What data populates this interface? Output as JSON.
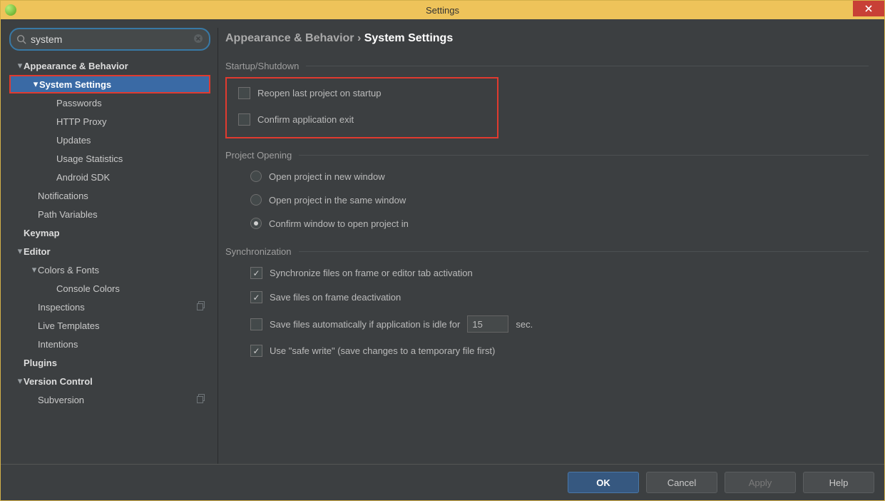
{
  "titlebar": {
    "title": "Settings"
  },
  "search": {
    "value": "system"
  },
  "sidebar": {
    "items": [
      {
        "label": "Appearance & Behavior",
        "indent": 1,
        "bold": true,
        "arrow": true
      },
      {
        "label": "System Settings",
        "indent": 2,
        "bold": true,
        "arrow": true,
        "selected": true,
        "redbox": true
      },
      {
        "label": "Passwords",
        "indent": 3
      },
      {
        "label": "HTTP Proxy",
        "indent": 3
      },
      {
        "label": "Updates",
        "indent": 3
      },
      {
        "label": "Usage Statistics",
        "indent": 3
      },
      {
        "label": "Android SDK",
        "indent": 3
      },
      {
        "label": "Notifications",
        "indent": 2
      },
      {
        "label": "Path Variables",
        "indent": 2
      },
      {
        "label": "Keymap",
        "indent": 1,
        "bold": true
      },
      {
        "label": "Editor",
        "indent": 1,
        "bold": true,
        "arrow": true
      },
      {
        "label": "Colors & Fonts",
        "indent": 2,
        "arrow": true
      },
      {
        "label": "Console Colors",
        "indent": 3
      },
      {
        "label": "Inspections",
        "indent": 2,
        "copy": true
      },
      {
        "label": "Live Templates",
        "indent": 2
      },
      {
        "label": "Intentions",
        "indent": 2
      },
      {
        "label": "Plugins",
        "indent": 1,
        "bold": true
      },
      {
        "label": "Version Control",
        "indent": 1,
        "bold": true,
        "arrow": true
      },
      {
        "label": "Subversion",
        "indent": 2,
        "copy": true
      }
    ]
  },
  "breadcrumb": {
    "parent": "Appearance & Behavior",
    "sep": " › ",
    "current": "System Settings"
  },
  "sections": {
    "startup": {
      "title": "Startup/Shutdown",
      "opts": [
        {
          "label": "Reopen last project on startup",
          "checked": false
        },
        {
          "label": "Confirm application exit",
          "checked": false
        }
      ]
    },
    "opening": {
      "title": "Project Opening",
      "opts": [
        {
          "label": "Open project in new window",
          "checked": false
        },
        {
          "label": "Open project in the same window",
          "checked": false
        },
        {
          "label": "Confirm window to open project in",
          "checked": true
        }
      ]
    },
    "sync": {
      "title": "Synchronization",
      "idle_value": "15",
      "idle_unit": "sec.",
      "opts": [
        {
          "label": "Synchronize files on frame or editor tab activation",
          "checked": true
        },
        {
          "label": "Save files on frame deactivation",
          "checked": true
        },
        {
          "label": "Save files automatically if application is idle for",
          "checked": false
        },
        {
          "label": "Use \"safe write\" (save changes to a temporary file first)",
          "checked": true
        }
      ]
    }
  },
  "footer": {
    "ok": "OK",
    "cancel": "Cancel",
    "apply": "Apply",
    "help": "Help"
  }
}
